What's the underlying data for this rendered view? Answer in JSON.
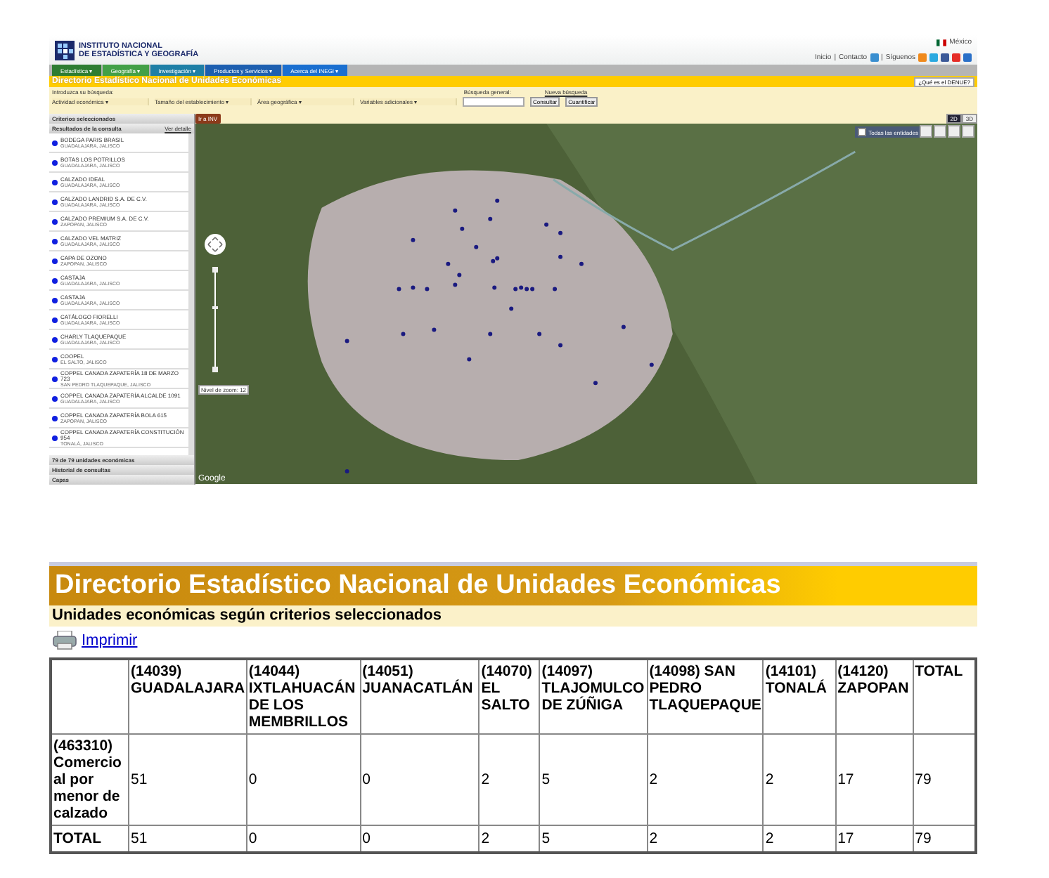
{
  "inegi": {
    "header": {
      "logo_lines": [
        "INSTITUTO NACIONAL",
        "DE ESTADÍSTICA Y GEOGRAFÍA"
      ],
      "country": "México",
      "links": [
        "Inicio",
        "Contacto",
        "Síguenos"
      ],
      "separator": "|"
    },
    "nav": [
      {
        "label": "Estadística ▾",
        "color": "#2e7d32"
      },
      {
        "label": "Geografía ▾",
        "color": "#43a047"
      },
      {
        "label": "Investigación ▾",
        "color": "#1e7fa6"
      },
      {
        "label": "Productos y Servicios ▾",
        "color": "#1d5fb0"
      },
      {
        "label": "Acerca del INEGI ▾",
        "color": "#1a6fd0"
      }
    ],
    "title": "Directorio Estadístico Nacional de Unidades Económicas",
    "help_button": "¿Qué es el DENUE?",
    "search": {
      "prompt": "Introduzca su búsqueda:",
      "filters": [
        "Actividad económica ▾",
        "Tamaño del establecimiento ▾",
        "Área geográfica ▾",
        "Variables adicionales ▾"
      ],
      "general_label": "Búsqueda general:",
      "new_search": "Nueva búsqueda",
      "buttons": [
        "Consultar",
        "Cuantificar"
      ]
    },
    "sidebar": {
      "criteria": "Criterios seleccionados",
      "results_title": "Resultados de la consulta",
      "detail_link": "Ver detalle",
      "results": [
        {
          "name": "BODEGA PARIS BRASIL",
          "location": "GUADALAJARA, JALISCO"
        },
        {
          "name": "BOTAS LOS POTRILLOS",
          "location": "GUADALAJARA, JALISCO"
        },
        {
          "name": "CALZADO IDEAL",
          "location": "GUADALAJARA, JALISCO"
        },
        {
          "name": "CALZADO LANDRID S.A. DE C.V.",
          "location": "GUADALAJARA, JALISCO"
        },
        {
          "name": "CALZADO PREMIUM S.A. DE C.V.",
          "location": "ZAPOPAN, JALISCO"
        },
        {
          "name": "CALZADO VEL MATRIZ",
          "location": "GUADALAJARA, JALISCO"
        },
        {
          "name": "CAPA DE OZONO",
          "location": "ZAPOPAN, JALISCO"
        },
        {
          "name": "CASTAJA",
          "location": "GUADALAJARA, JALISCO"
        },
        {
          "name": "CASTAJA",
          "location": "GUADALAJARA, JALISCO"
        },
        {
          "name": "CATÁLOGO FIORELLI",
          "location": "GUADALAJARA, JALISCO"
        },
        {
          "name": "CHARLY TLAQUEPAQUE",
          "location": "GUADALAJARA, JALISCO"
        },
        {
          "name": "COOPEL",
          "location": "EL SALTO, JALISCO"
        },
        {
          "name": "COPPEL CANADA ZAPATERÍA 18 DE MARZO 723",
          "location": "SAN PEDRO TLAQUEPAQUE, JALISCO"
        },
        {
          "name": "COPPEL CANADA ZAPATERÍA ALCALDE 1091",
          "location": "GUADALAJARA, JALISCO"
        },
        {
          "name": "COPPEL CANADA ZAPATERÍA BOLA 615",
          "location": "ZAPOPAN, JALISCO"
        },
        {
          "name": "COPPEL CANADA ZAPATERÍA CONSTITUCIÓN 954",
          "location": "TONALÁ, JALISCO"
        }
      ],
      "count": "79 de 79 unidades económicas",
      "panels": [
        "Historial de consultas",
        "Capas"
      ]
    },
    "map": {
      "goto_button": "Ir a INV",
      "zoom_label": "Nivel de zoom: 12",
      "layers_checkbox": {
        "label": "Todas las entidades",
        "checked": false
      },
      "view_modes": [
        {
          "label": "2D",
          "selected": true
        },
        {
          "label": "3D",
          "selected": false
        }
      ],
      "brand": "Google"
    }
  },
  "report": {
    "title": "Directorio Estadístico Nacional de Unidades Económicas",
    "subtitle": "Unidades económicas según criterios seleccionados",
    "print_link": "Imprimir",
    "table": {
      "columns": [
        "",
        "(14039) GUADALAJARA",
        "(14044) IXTLAHUACÁN DE LOS MEMBRILLOS",
        "(14051) JUANACATLÁN",
        "(14070) EL SALTO",
        "(14097) TLAJOMULCO DE ZÚÑIGA",
        "(14098) SAN PEDRO TLAQUEPAQUE",
        "(14101) TONALÁ",
        "(14120) ZAPOPAN",
        "TOTAL"
      ],
      "rows": [
        {
          "cells": [
            "(463310) Comercio al por menor de calzado",
            "51",
            "0",
            "0",
            "2",
            "5",
            "2",
            "2",
            "17",
            "79"
          ]
        },
        {
          "cells": [
            "TOTAL",
            "51",
            "0",
            "0",
            "2",
            "5",
            "2",
            "2",
            "17",
            "79"
          ]
        }
      ]
    }
  }
}
